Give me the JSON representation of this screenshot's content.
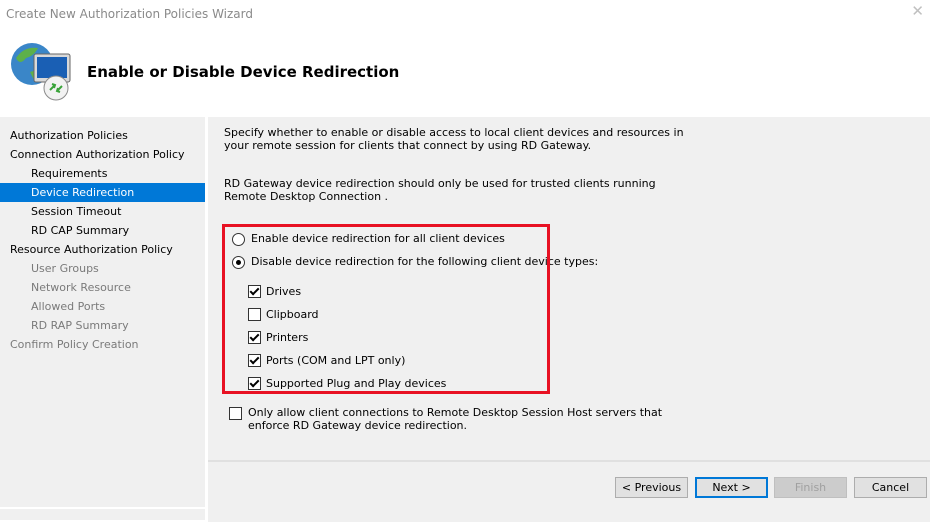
{
  "window": {
    "title": "Create New Authorization Policies Wizard",
    "close_glyph": "✕"
  },
  "header": {
    "title": "Enable or Disable Device Redirection",
    "icon": "remote-desktop-gateway-icon"
  },
  "nav": {
    "items": [
      {
        "label": "Authorization Policies",
        "level": "top",
        "state": "normal"
      },
      {
        "label": "Connection Authorization Policy",
        "level": "top",
        "state": "normal"
      },
      {
        "label": "Requirements",
        "level": "sub",
        "state": "normal"
      },
      {
        "label": "Device Redirection",
        "level": "sub",
        "state": "selected"
      },
      {
        "label": "Session Timeout",
        "level": "sub",
        "state": "normal"
      },
      {
        "label": "RD CAP Summary",
        "level": "sub",
        "state": "normal"
      },
      {
        "label": "Resource Authorization Policy",
        "level": "top",
        "state": "normal"
      },
      {
        "label": "User Groups",
        "level": "sub",
        "state": "disabled"
      },
      {
        "label": "Network Resource",
        "level": "sub",
        "state": "disabled"
      },
      {
        "label": "Allowed Ports",
        "level": "sub",
        "state": "disabled"
      },
      {
        "label": "RD RAP Summary",
        "level": "sub",
        "state": "disabled"
      },
      {
        "label": "Confirm Policy Creation",
        "level": "top",
        "state": "disabled"
      }
    ]
  },
  "content": {
    "intro": "Specify whether to enable or disable access to local client devices and resources in your remote session for clients that connect by using RD Gateway.",
    "note": "RD Gateway device redirection should only be used for trusted clients running Remote Desktop Connection .",
    "radio_enable": {
      "label": "Enable device redirection for all client devices",
      "checked": false
    },
    "radio_disable": {
      "label": "Disable device redirection for the following client device types:",
      "checked": true
    },
    "devices": [
      {
        "label": "Drives",
        "checked": true
      },
      {
        "label": "Clipboard",
        "checked": false
      },
      {
        "label": "Printers",
        "checked": true
      },
      {
        "label": "Ports (COM and LPT only)",
        "checked": true
      },
      {
        "label": "Supported Plug and Play devices",
        "checked": true
      }
    ],
    "enforce": {
      "label": "Only allow client connections to Remote Desktop Session Host servers that enforce RD Gateway device redirection.",
      "checked": false
    },
    "highlight_color": "#e81123"
  },
  "footer": {
    "previous_label": "< Previous",
    "next_label": "Next >",
    "finish_label": "Finish",
    "cancel_label": "Cancel"
  },
  "colors": {
    "selection": "#0078d7",
    "panel": "#f0f0f0"
  }
}
